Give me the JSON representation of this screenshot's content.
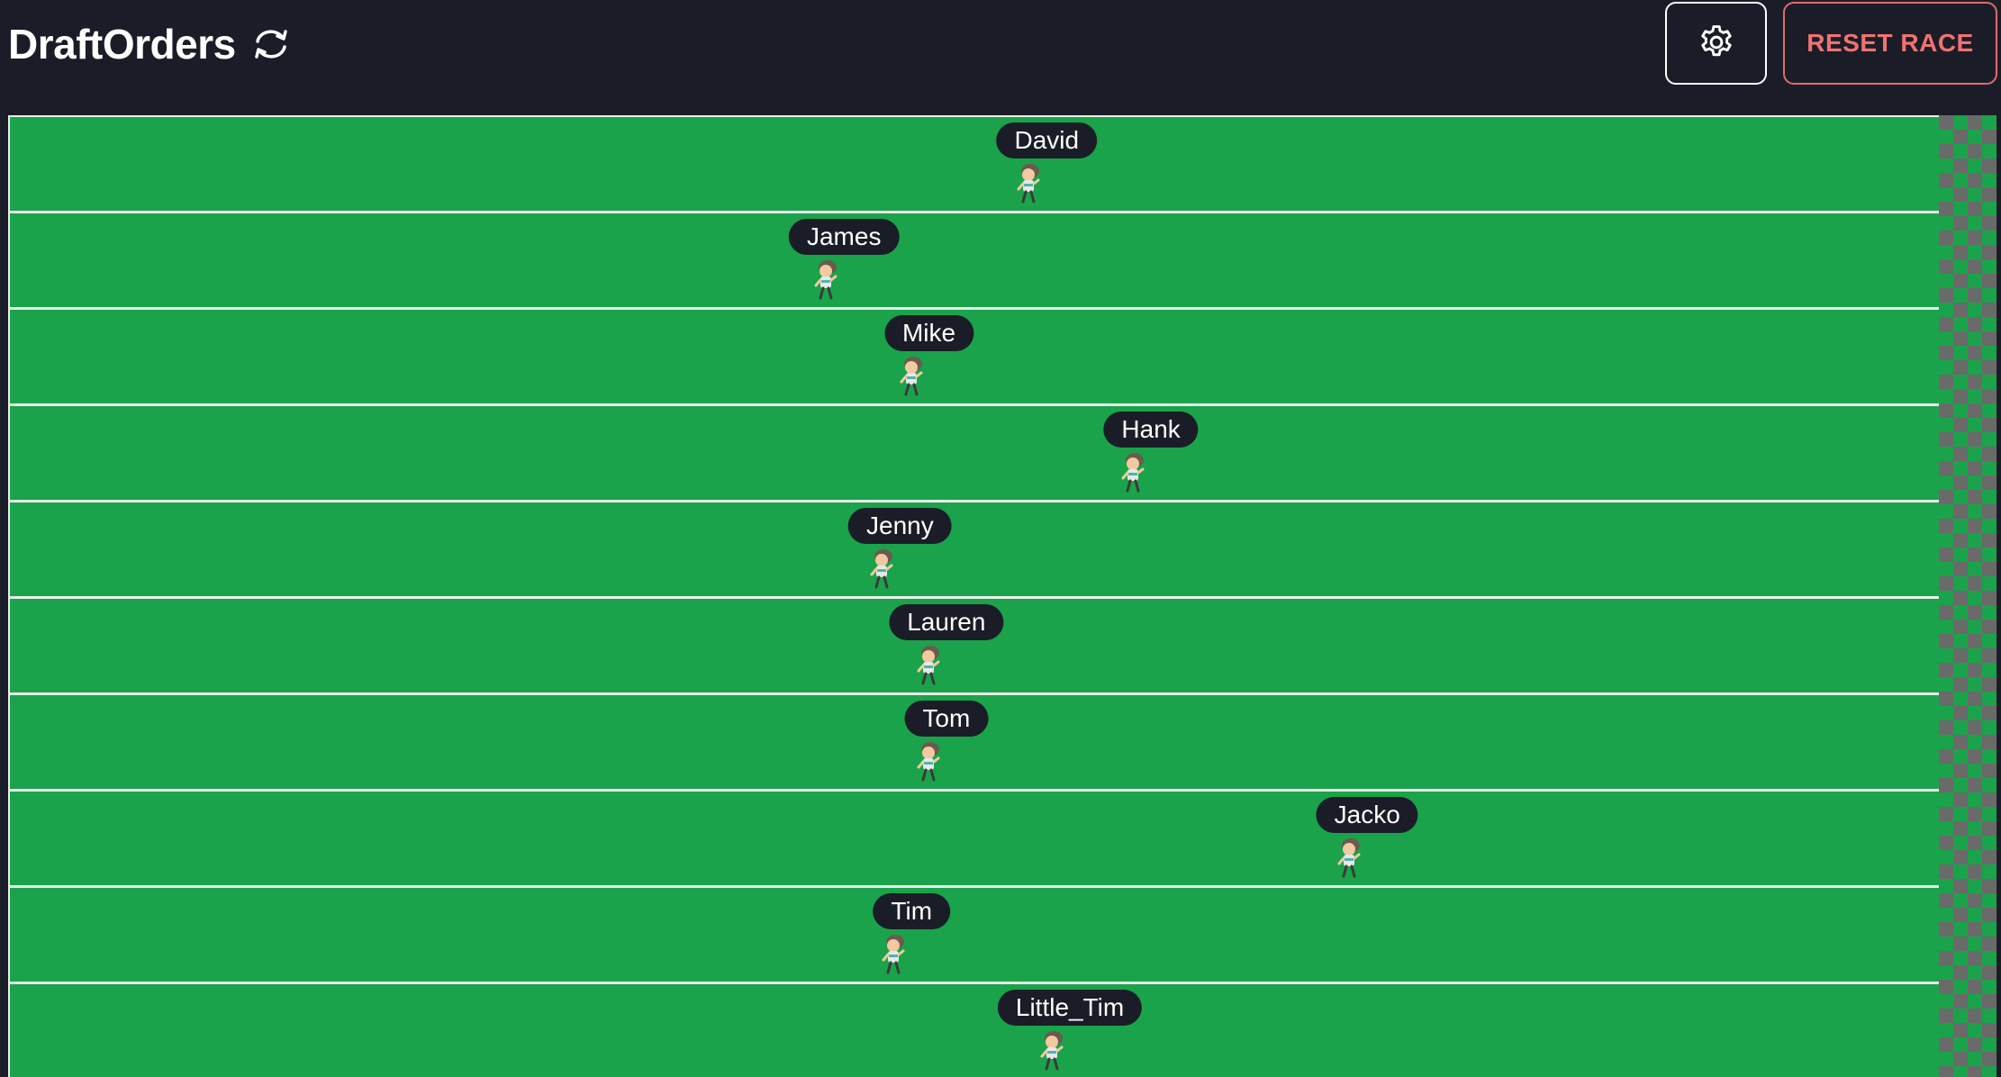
{
  "header": {
    "title": "DraftOrders",
    "refresh_icon": "refresh-icon",
    "settings_icon": "gear-icon",
    "reset_label": "RESET RACE"
  },
  "colors": {
    "header_bg": "#1a1d27",
    "track_green": "#1aa34a",
    "lane_line": "#e9f0ea",
    "reset_accent": "#f07272",
    "name_tag_bg": "#1a1d27"
  },
  "race": {
    "finish_icon": "checkered-flag",
    "runners": [
      {
        "name": "David",
        "progress": 0.537
      },
      {
        "name": "James",
        "progress": 0.432
      },
      {
        "name": "Mike",
        "progress": 0.476
      },
      {
        "name": "Hank",
        "progress": 0.591
      },
      {
        "name": "Jenny",
        "progress": 0.461
      },
      {
        "name": "Lauren",
        "progress": 0.485
      },
      {
        "name": "Tom",
        "progress": 0.485
      },
      {
        "name": "Jacko",
        "progress": 0.703
      },
      {
        "name": "Tim",
        "progress": 0.467
      },
      {
        "name": "Little_Tim",
        "progress": 0.549
      }
    ]
  }
}
